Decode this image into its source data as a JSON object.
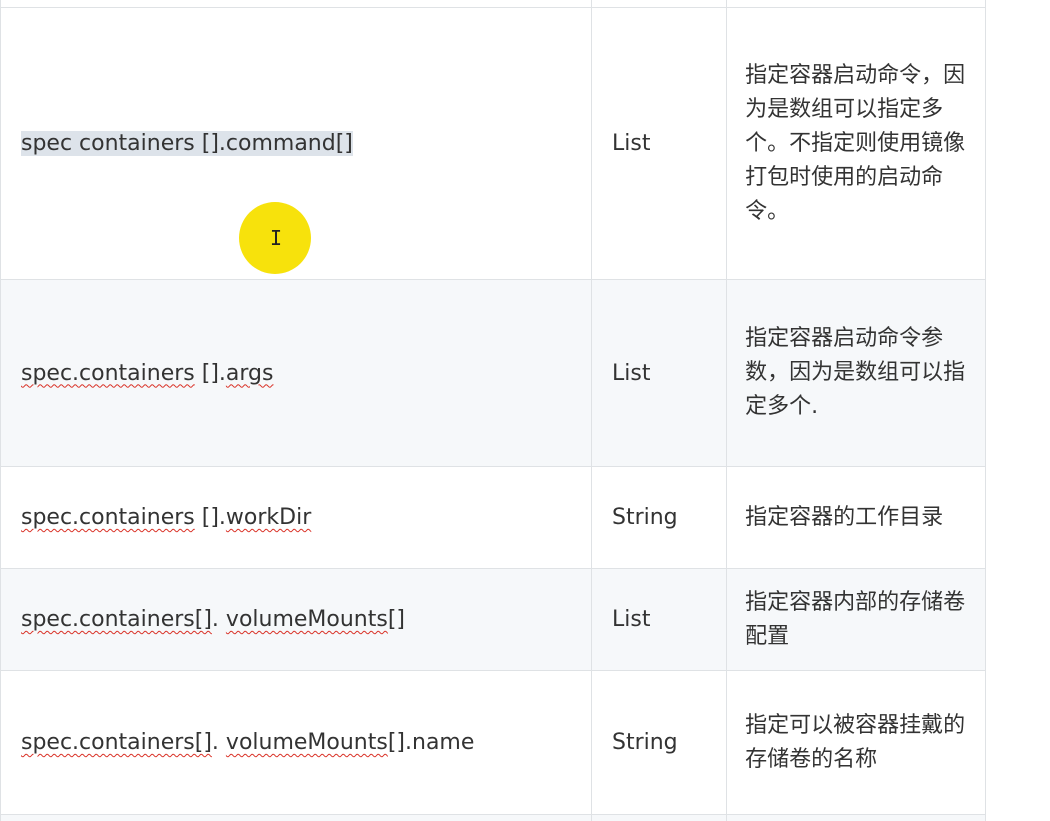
{
  "table": {
    "rows": [
      {
        "name_parts": [
          {
            "text": "spec containers [].command[]",
            "style": "selected"
          }
        ],
        "type": "List",
        "desc": "指定容器启动命令，因为是数组可以指定多个。不指定则使用镜像打包时使用的启动命令。"
      },
      {
        "name_parts": [
          {
            "text": "spec.containers",
            "style": "spell"
          },
          {
            "text": " [].",
            "style": "plain"
          },
          {
            "text": "args",
            "style": "spell"
          }
        ],
        "type": "List",
        "desc": "指定容器启动命令参数，因为是数组可以指定多个."
      },
      {
        "name_parts": [
          {
            "text": "spec.containers",
            "style": "spell"
          },
          {
            "text": " [].",
            "style": "plain"
          },
          {
            "text": "workDir",
            "style": "spell"
          }
        ],
        "type": "String",
        "desc": "指定容器的工作目录"
      },
      {
        "name_parts": [
          {
            "text": "spec.containers[]",
            "style": "spell"
          },
          {
            "text": ". ",
            "style": "plain"
          },
          {
            "text": "volumeMounts",
            "style": "spell"
          },
          {
            "text": "[]",
            "style": "plain"
          }
        ],
        "type": "List",
        "desc": "指定容器内部的存储卷配置"
      },
      {
        "name_parts": [
          {
            "text": "spec.containers[]",
            "style": "spell"
          },
          {
            "text": ". ",
            "style": "plain"
          },
          {
            "text": "volumeMounts",
            "style": "spell"
          },
          {
            "text": "[].name",
            "style": "plain"
          }
        ],
        "type": "String",
        "desc": "指定可以被容器挂戴的存储卷的名称"
      }
    ]
  },
  "cursor": {
    "glyph": "I",
    "highlight_color": "#f7e20c"
  },
  "colors": {
    "border": "#dfe2e5",
    "stripe": "#f6f8fa",
    "text": "#333333",
    "selection": "#dde3ea",
    "spellcheck": "#d93025"
  }
}
